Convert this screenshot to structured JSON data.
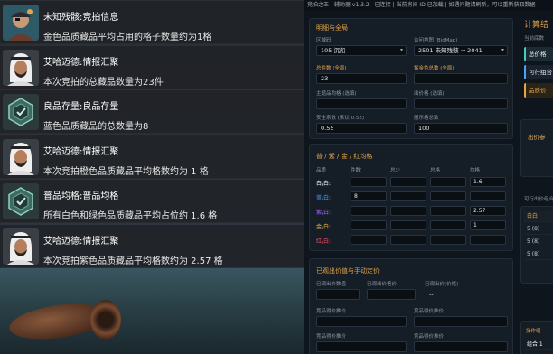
{
  "feed": [
    {
      "avatar": "pirate-avatar",
      "title": "未知残骸:竞拍信息",
      "desc": "金色品质藏品平均占用的格子数量约为1格"
    },
    {
      "avatar": "arab-merchant-avatar",
      "title": "艾哈迈德:情报汇聚",
      "desc": "本次竞拍的总藏品数量为23件"
    },
    {
      "avatar": "hex-badge-avatar",
      "title": "良品存量:良品存量",
      "desc": "蓝色品质藏品的总数量为8"
    },
    {
      "avatar": "arab-merchant-avatar",
      "title": "艾哈迈德:情报汇聚",
      "desc": "本次竞拍橙色品质藏品平均格数约为 1 格"
    },
    {
      "avatar": "hex-badge-avatar",
      "title": "普品均格:普品均格",
      "desc": "所有白色和绿色品质藏品平均占位约 1.6 格"
    },
    {
      "avatar": "arab-merchant-avatar",
      "title": "艾哈迈德:情报汇聚",
      "desc": "本次竞拍紫色品质藏品平均格数约为 2.57 格"
    }
  ],
  "main": {
    "topbar": "竞拍之王 - 辅助器 v1.3.2 - 已连接 | 当前房间 ID 已加载 | 如遇问题请刷新，可以重新获取数据",
    "basic": {
      "header": "明细与全局",
      "zone_label": "区域码",
      "zone_value": "105 沉船",
      "path_label": "访问地图 (BidMap)",
      "path_value": "2501 未知残骸 → 2041",
      "total_label": "总件数 (全局)",
      "total_value": "23",
      "gold_total_label": "紫金色总数 (全局)",
      "gold_total_value": "",
      "theme_label": "主题品均格 (选填)",
      "theme_value": "",
      "outgrid_label": "出价格 (选填)",
      "outgrid_value": "",
      "safety_label": "安全系数 (默认 0.55)",
      "safety_value": "0.55",
      "showcase_label": "展示格总数",
      "showcase_value": "100"
    },
    "grid": {
      "header": "普 / 紫 / 金 / 红均格",
      "columns": [
        "品质",
        "件数",
        "总少",
        "总格",
        "均格"
      ],
      "rows": [
        {
          "label": "白/白:",
          "color": "#ffffff",
          "values": [
            "",
            "",
            "",
            "1.6"
          ]
        },
        {
          "label": "蓝/白:",
          "color": "#4aa3ff",
          "values": [
            "8",
            "",
            "",
            ""
          ]
        },
        {
          "label": "紫/白:",
          "color": "#b06cff",
          "values": [
            "",
            "",
            "",
            "2.57"
          ]
        },
        {
          "label": "金/白:",
          "color": "#ffc34d",
          "values": [
            "",
            "",
            "",
            "1"
          ]
        },
        {
          "label": "红/白:",
          "color": "#ff4d6a",
          "values": [
            "",
            "",
            "",
            ""
          ]
        }
      ]
    },
    "bid": {
      "header": "已观出价值与手动定价",
      "f1_label": "已观出价数值",
      "f2_label": "已观出价格价",
      "f3_label": "已观出价(价格)",
      "f3_value": "--",
      "f4_label": "竞品得价推价",
      "f5_label": "竞品得价推价",
      "f6_label": "竞品得价推价",
      "f7_label": "竞品得价推价"
    },
    "right": {
      "title": "计算结",
      "subtitle": "当前底数",
      "item1": "总价格",
      "item2": "可行组合",
      "item3": "品质价",
      "out_label": "出价参",
      "combo_label": "可行出价组合",
      "table_header": "白白",
      "rows": [
        "5 (8)",
        "5 (8)",
        "5 (8)"
      ],
      "bottom_header": "操作组",
      "bottom_value": "组合 1"
    },
    "colors": {
      "accent": "#e5a44a",
      "panel": "#151d26",
      "field": "#0a0f14"
    }
  }
}
